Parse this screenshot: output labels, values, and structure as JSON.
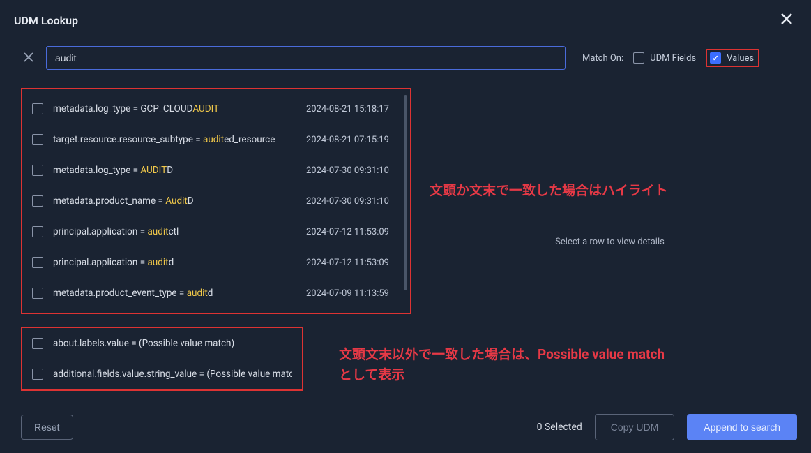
{
  "header": {
    "title": "UDM Lookup"
  },
  "search": {
    "value": "audit",
    "match_on_label": "Match On:",
    "udm_fields_label": "UDM Fields",
    "values_label": "Values"
  },
  "results": {
    "group1": [
      {
        "pre": "metadata.log_type = GCP_CLOUD",
        "hl": "AUDIT",
        "post": "",
        "time": "2024-08-21 15:18:17"
      },
      {
        "pre": "target.resource.resource_subtype = ",
        "hl": "audit",
        "post": "ed_resource",
        "time": "2024-08-21 07:15:19"
      },
      {
        "pre": "metadata.log_type = ",
        "hl": "AUDIT",
        "post": "D",
        "time": "2024-07-30 09:31:10"
      },
      {
        "pre": "metadata.product_name = ",
        "hl": "Audit",
        "post": "D",
        "time": "2024-07-30 09:31:10"
      },
      {
        "pre": "principal.application = ",
        "hl": "audit",
        "post": "ctl",
        "time": "2024-07-12 11:53:09"
      },
      {
        "pre": "principal.application = ",
        "hl": "audit",
        "post": "d",
        "time": "2024-07-12 11:53:09"
      },
      {
        "pre": "metadata.product_event_type = ",
        "hl": "audit",
        "post": "d",
        "time": "2024-07-09 11:13:59"
      }
    ],
    "group2": [
      {
        "text": "about.labels.value = (Possible value match)"
      },
      {
        "text": "additional.fields.value.string_value = (Possible value match)"
      }
    ]
  },
  "annotations": {
    "a1": "文頭か文末で一致した場合はハイライト",
    "a2_l1": "文頭文末以外で一致した場合は、Possible value match",
    "a2_l2": "として表示"
  },
  "details": {
    "hint": "Select a row to view details"
  },
  "footer": {
    "reset": "Reset",
    "selected": "0 Selected",
    "copy": "Copy UDM",
    "append": "Append to search"
  }
}
